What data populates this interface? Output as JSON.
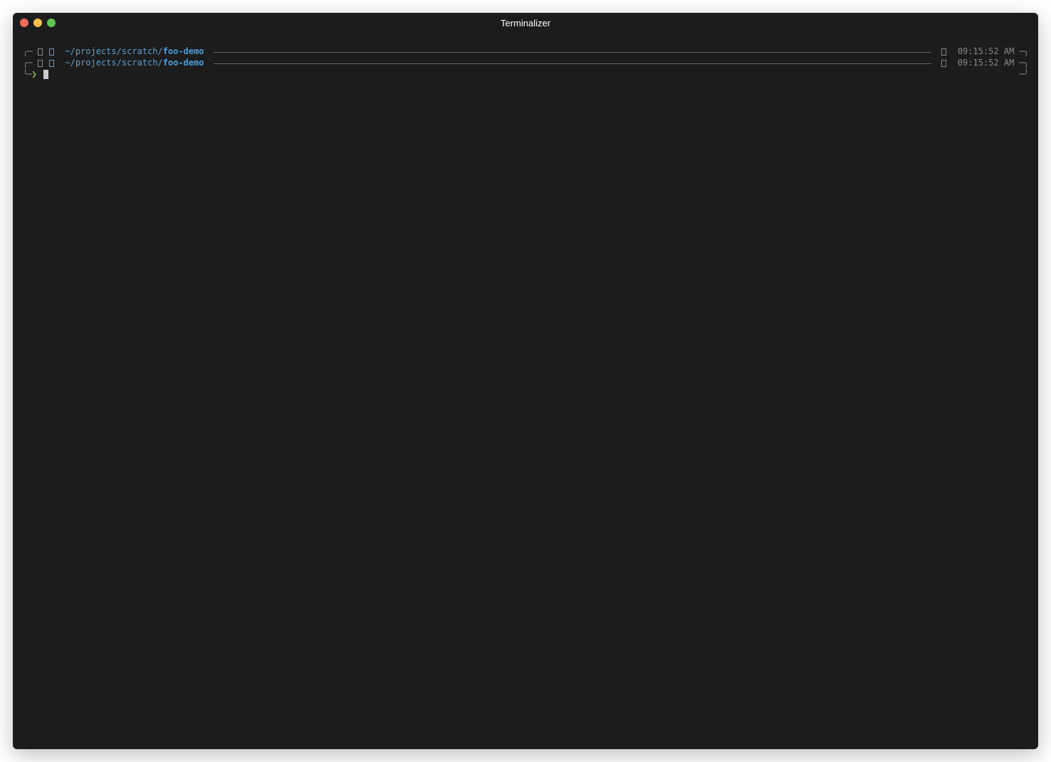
{
  "window": {
    "title": "Terminalizer"
  },
  "prompt": {
    "lines": [
      {
        "corner_left": "╭─",
        "icon1": "",
        "icon2": "",
        "path_prefix": "~/projects/scratch/",
        "path_dir": "foo-demo",
        "clock_icon": "",
        "time": "09:15:52 AM",
        "corner_right": "─╮"
      },
      {
        "corner_left": "╭─",
        "icon1": "",
        "icon2": "",
        "path_prefix": "~/projects/scratch/",
        "path_dir": "foo-demo",
        "clock_icon": "",
        "time": "09:15:52 AM",
        "corner_right": "─╮"
      }
    ],
    "input_line": {
      "corner_left": "╰─",
      "arrow": "❯",
      "corner_right": "─╯"
    }
  }
}
